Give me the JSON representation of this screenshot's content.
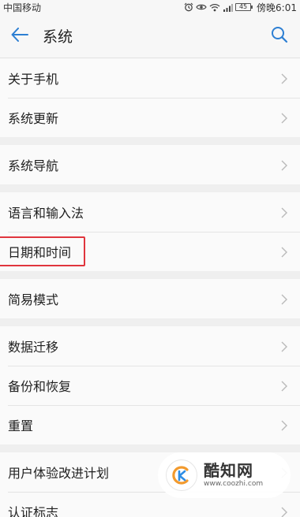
{
  "status_bar": {
    "carrier": "中国移动",
    "battery": "45",
    "time": "傍晚6:01",
    "icons": [
      "alarm-icon",
      "eye-icon",
      "wifi-icon",
      "signal-icon",
      "battery-icon"
    ]
  },
  "header": {
    "title": "系统",
    "back_icon": "back-arrow-icon",
    "search_icon": "search-icon",
    "accent_color": "#2d7fd3"
  },
  "groups": [
    {
      "items": [
        {
          "label": "关于手机"
        },
        {
          "label": "系统更新"
        }
      ]
    },
    {
      "items": [
        {
          "label": "系统导航"
        }
      ]
    },
    {
      "items": [
        {
          "label": "语言和输入法"
        },
        {
          "label": "日期和时间",
          "highlighted": true
        }
      ]
    },
    {
      "items": [
        {
          "label": "简易模式"
        }
      ]
    },
    {
      "items": [
        {
          "label": "数据迁移"
        },
        {
          "label": "备份和恢复"
        },
        {
          "label": "重置"
        }
      ]
    },
    {
      "items": [
        {
          "label": "用户体验改进计划"
        },
        {
          "label": "认证标志"
        }
      ]
    }
  ],
  "highlight_color": "#e0353d",
  "watermark": {
    "title": "酷知网",
    "url": "www.coozhi.com"
  }
}
